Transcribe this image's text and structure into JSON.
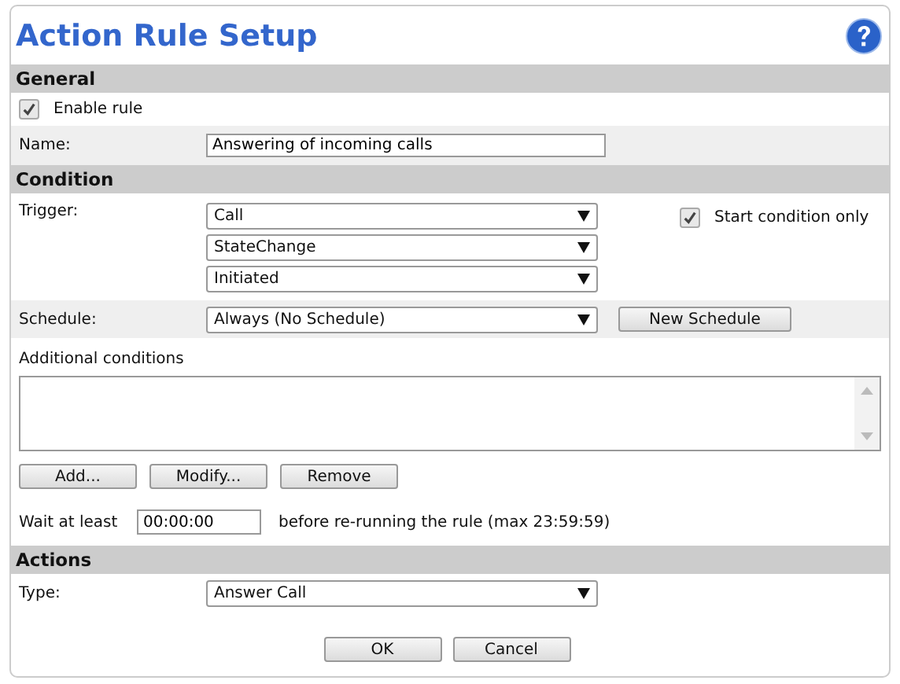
{
  "title": "Action Rule Setup",
  "general": {
    "heading": "General",
    "enable_rule": {
      "label": "Enable rule",
      "checked": true
    },
    "name": {
      "label": "Name:",
      "value": "Answering of incoming calls"
    }
  },
  "condition": {
    "heading": "Condition",
    "trigger": {
      "label": "Trigger:",
      "selects": [
        "Call",
        "StateChange",
        "Initiated"
      ],
      "start_condition_only": {
        "label": "Start condition only",
        "checked": true
      }
    },
    "schedule": {
      "label": "Schedule:",
      "value": "Always (No Schedule)",
      "button": "New Schedule"
    },
    "additional": {
      "label": "Additional conditions",
      "buttons": [
        "Add...",
        "Modify...",
        "Remove"
      ]
    },
    "wait": {
      "label": "Wait at least",
      "value": "00:00:00",
      "suffix": "before re-running the rule (max 23:59:59)"
    }
  },
  "actions": {
    "heading": "Actions",
    "type": {
      "label": "Type:",
      "value": "Answer Call"
    }
  },
  "buttons": [
    "OK",
    "Cancel"
  ]
}
